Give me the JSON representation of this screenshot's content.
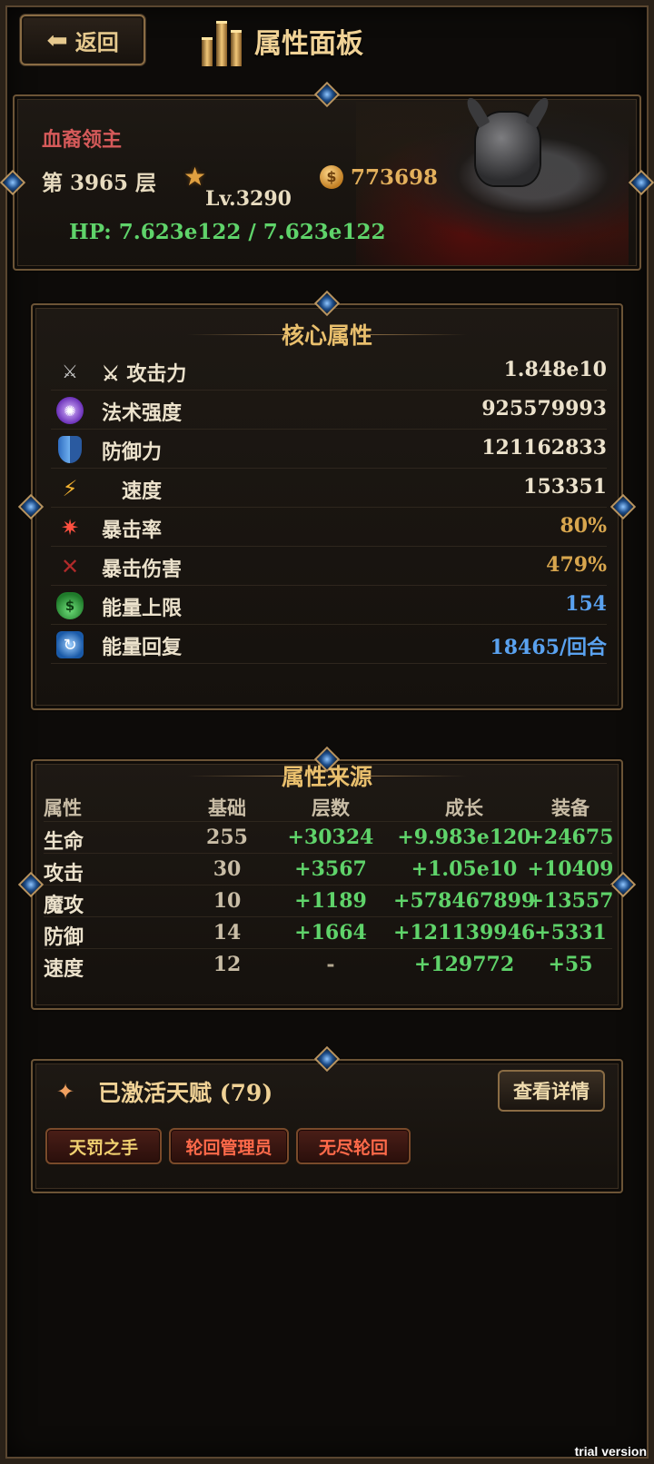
{
  "header": {
    "back_label": "返回",
    "title": "属性面板"
  },
  "boss": {
    "name": "血裔领主",
    "floor": "第 3965 层",
    "level": "Lv.3290",
    "gold": "773698",
    "hp": "HP: 7.623e122 / 7.623e122"
  },
  "core": {
    "title": "核心属性",
    "stats": [
      {
        "icon": "crossed-swords-icon",
        "label": "⚔ 攻击力",
        "value": "1.848e10",
        "color": "#ece2cc"
      },
      {
        "icon": "magic-orb-icon",
        "label": "法术强度",
        "value": "925579993",
        "color": "#ece2cc"
      },
      {
        "icon": "shield-icon",
        "label": "防御力",
        "value": "121162833",
        "color": "#ece2cc"
      },
      {
        "icon": "lightning-icon",
        "label": "速度",
        "value": "153351",
        "color": "#ece2cc"
      },
      {
        "icon": "crit-burst-icon",
        "label": "暴击率",
        "value": "80%",
        "color": "#d8a64e"
      },
      {
        "icon": "crit-damage-icon",
        "label": "暴击伤害",
        "value": "479%",
        "color": "#d8a64e"
      },
      {
        "icon": "potion-icon",
        "label": "能量上限",
        "value": "154",
        "color": "#5aa2f0"
      },
      {
        "icon": "swirl-icon",
        "label": "能量回复",
        "value": "18465/回合",
        "color": "#5aa2f0"
      }
    ]
  },
  "source": {
    "title": "属性来源",
    "headers": [
      "属性",
      "基础",
      "层数",
      "成长",
      "装备"
    ],
    "rows": [
      [
        "生命",
        "255",
        "+30324",
        "+9.983e120",
        "+24675"
      ],
      [
        "攻击",
        "30",
        "+3567",
        "+1.05e10",
        "+10409"
      ],
      [
        "魔攻",
        "10",
        "+1189",
        "+578467899",
        "+13557"
      ],
      [
        "防御",
        "14",
        "+1664",
        "+121139946",
        "+5331"
      ],
      [
        "速度",
        "12",
        "-",
        "+129772",
        "+55"
      ]
    ]
  },
  "talents": {
    "title": "已激活天赋 (79)",
    "detail_button": "查看详情",
    "tags": [
      "天罚之手",
      "轮回管理员",
      "无尽轮回"
    ]
  },
  "watermark": "trial version"
}
